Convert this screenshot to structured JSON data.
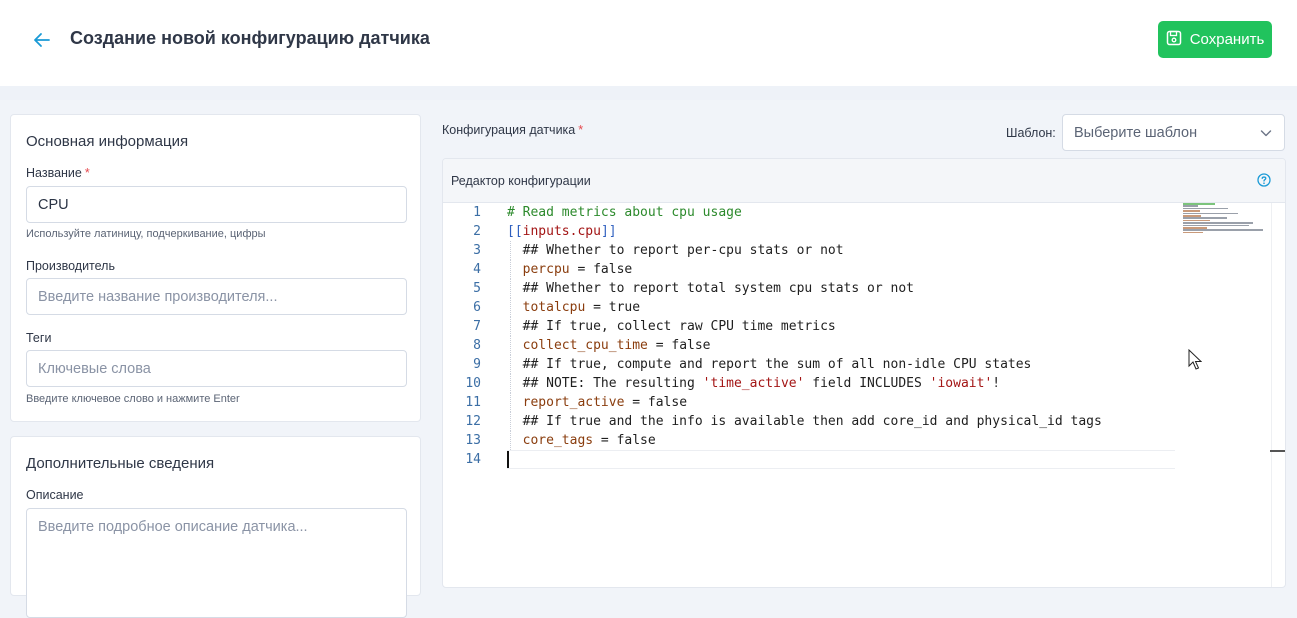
{
  "header": {
    "title": "Создание новой конфигурацию датчика",
    "save_label": "Сохранить"
  },
  "main_info": {
    "title": "Основная информация",
    "name_label": "Название",
    "name_value": "CPU",
    "name_hint": "Используйте латиницу, подчеркивание, цифры",
    "vendor_label": "Производитель",
    "vendor_placeholder": "Введите название производителя...",
    "tags_label": "Теги",
    "tags_placeholder": "Ключевые слова",
    "tags_hint": "Введите ключевое слово и нажмите Enter"
  },
  "extra_info": {
    "title": "Дополнительные сведения",
    "description_label": "Описание",
    "description_placeholder": "Введите подробное описание датчика..."
  },
  "config": {
    "label": "Конфигурация датчика",
    "template_label": "Шаблон:",
    "template_placeholder": "Выберите шаблон",
    "editor_title": "Редактор конфигурации"
  },
  "code_lines": [
    {
      "n": "1",
      "parts": [
        {
          "t": "# Read metrics about cpu usage",
          "c": "c-comment"
        }
      ]
    },
    {
      "n": "2",
      "parts": [
        {
          "t": "[[",
          "c": "c-bracket"
        },
        {
          "t": "inputs.cpu",
          "c": "c-section"
        },
        {
          "t": "]]",
          "c": "c-bracket"
        }
      ]
    },
    {
      "n": "3",
      "indent": true,
      "parts": [
        {
          "t": "  ## Whether to report per-cpu stats or not",
          "c": "c-text"
        }
      ]
    },
    {
      "n": "4",
      "indent": true,
      "parts": [
        {
          "t": "  percpu",
          "c": "c-key"
        },
        {
          "t": " = false",
          "c": "c-text"
        }
      ]
    },
    {
      "n": "5",
      "indent": true,
      "parts": [
        {
          "t": "  ## Whether to report total system cpu stats or not",
          "c": "c-text"
        }
      ]
    },
    {
      "n": "6",
      "indent": true,
      "parts": [
        {
          "t": "  totalcpu",
          "c": "c-key"
        },
        {
          "t": " = true",
          "c": "c-text"
        }
      ]
    },
    {
      "n": "7",
      "indent": true,
      "parts": [
        {
          "t": "  ## If true, collect raw CPU time metrics",
          "c": "c-text"
        }
      ]
    },
    {
      "n": "8",
      "indent": true,
      "parts": [
        {
          "t": "  collect_cpu_time",
          "c": "c-key"
        },
        {
          "t": " = false",
          "c": "c-text"
        }
      ]
    },
    {
      "n": "9",
      "indent": true,
      "parts": [
        {
          "t": "  ## If true, compute and report the sum of all non-idle CPU states",
          "c": "c-text"
        }
      ]
    },
    {
      "n": "10",
      "indent": true,
      "parts": [
        {
          "t": "  ## NOTE: The resulting ",
          "c": "c-text"
        },
        {
          "t": "'time_active'",
          "c": "c-str"
        },
        {
          "t": " field INCLUDES ",
          "c": "c-text"
        },
        {
          "t": "'iowait'",
          "c": "c-str"
        },
        {
          "t": "!",
          "c": "c-text"
        }
      ]
    },
    {
      "n": "11",
      "indent": true,
      "parts": [
        {
          "t": "  report_active",
          "c": "c-key"
        },
        {
          "t": " = false",
          "c": "c-text"
        }
      ]
    },
    {
      "n": "12",
      "indent": true,
      "parts": [
        {
          "t": "  ## If true and the info is available then add core_id and physical_id tags",
          "c": "c-text"
        }
      ]
    },
    {
      "n": "13",
      "indent": true,
      "parts": [
        {
          "t": "  core_tags",
          "c": "c-key"
        },
        {
          "t": " = false",
          "c": "c-text"
        }
      ]
    },
    {
      "n": "14",
      "parts": []
    }
  ],
  "colors": {
    "accent_green": "#21c35d",
    "back_arrow": "#1a9ad6",
    "help_icon": "#1a9ad6"
  },
  "icons": {
    "back": "arrow-left-icon",
    "save": "floppy-disk-icon",
    "help": "question-circle-icon",
    "select": "chevron-down-icon"
  }
}
